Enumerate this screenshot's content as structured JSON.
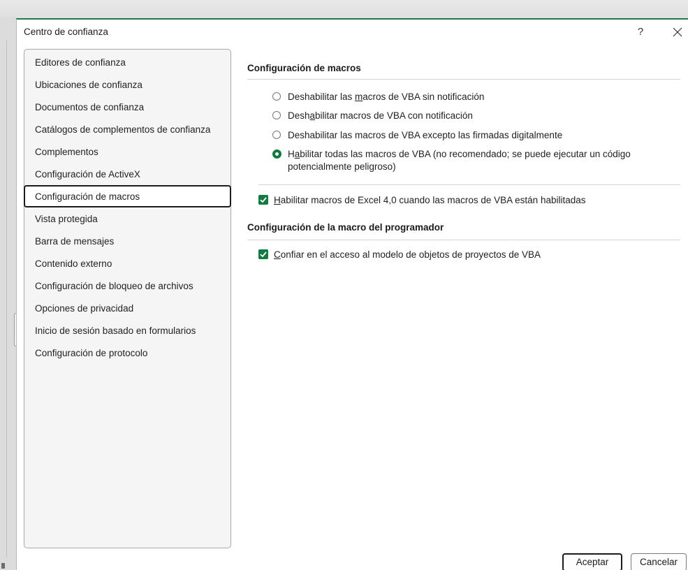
{
  "dialog": {
    "title": "Centro de confianza",
    "help_label": "?"
  },
  "nav": {
    "items": [
      {
        "label": "Editores de confianza",
        "selected": false
      },
      {
        "label": "Ubicaciones de confianza",
        "selected": false
      },
      {
        "label": "Documentos de confianza",
        "selected": false
      },
      {
        "label": "Catálogos de complementos de confianza",
        "selected": false
      },
      {
        "label": "Complementos",
        "selected": false
      },
      {
        "label": "Configuración de ActiveX",
        "selected": false
      },
      {
        "label": "Configuración de macros",
        "selected": true
      },
      {
        "label": "Vista protegida",
        "selected": false
      },
      {
        "label": "Barra de mensajes",
        "selected": false
      },
      {
        "label": "Contenido externo",
        "selected": false
      },
      {
        "label": "Configuración de bloqueo de archivos",
        "selected": false
      },
      {
        "label": "Opciones de privacidad",
        "selected": false
      },
      {
        "label": "Inicio de sesión basado en formularios",
        "selected": false
      },
      {
        "label": "Configuración de protocolo",
        "selected": false
      }
    ]
  },
  "macros": {
    "section_title": "Configuración de macros",
    "options": [
      {
        "pre": "Deshabilitar las ",
        "accel": "m",
        "post": "acros de VBA sin notificación",
        "selected": false
      },
      {
        "pre": "Desh",
        "accel": "a",
        "post": "bilitar macros de VBA con notificación",
        "selected": false
      },
      {
        "pre": "Deshabilitar las macros de VBA excepto las firmadas di",
        "accel": "g",
        "post": "italmente",
        "selected": false
      },
      {
        "pre": "H",
        "accel": "a",
        "post": "bilitar todas las macros de VBA (no recomendado; se puede ejecutar un código",
        "line2": "potencialmente peligroso)",
        "selected": true
      }
    ],
    "excel4": {
      "accel": "H",
      "text": "abilitar macros de Excel 4,0 cuando las macros de VBA están habilitadas",
      "checked": true
    }
  },
  "developer": {
    "section_title": "Configuración de la macro del programador",
    "vba_access": {
      "accel": "C",
      "text": "onfiar en el acceso al modelo de objetos de proyectos de VBA",
      "checked": true
    }
  },
  "buttons": {
    "ok_label": "Aceptar",
    "cancel_label": "Cancelar"
  },
  "colors": {
    "accent": "#127a3f",
    "title_accent": "#1f7a48"
  }
}
